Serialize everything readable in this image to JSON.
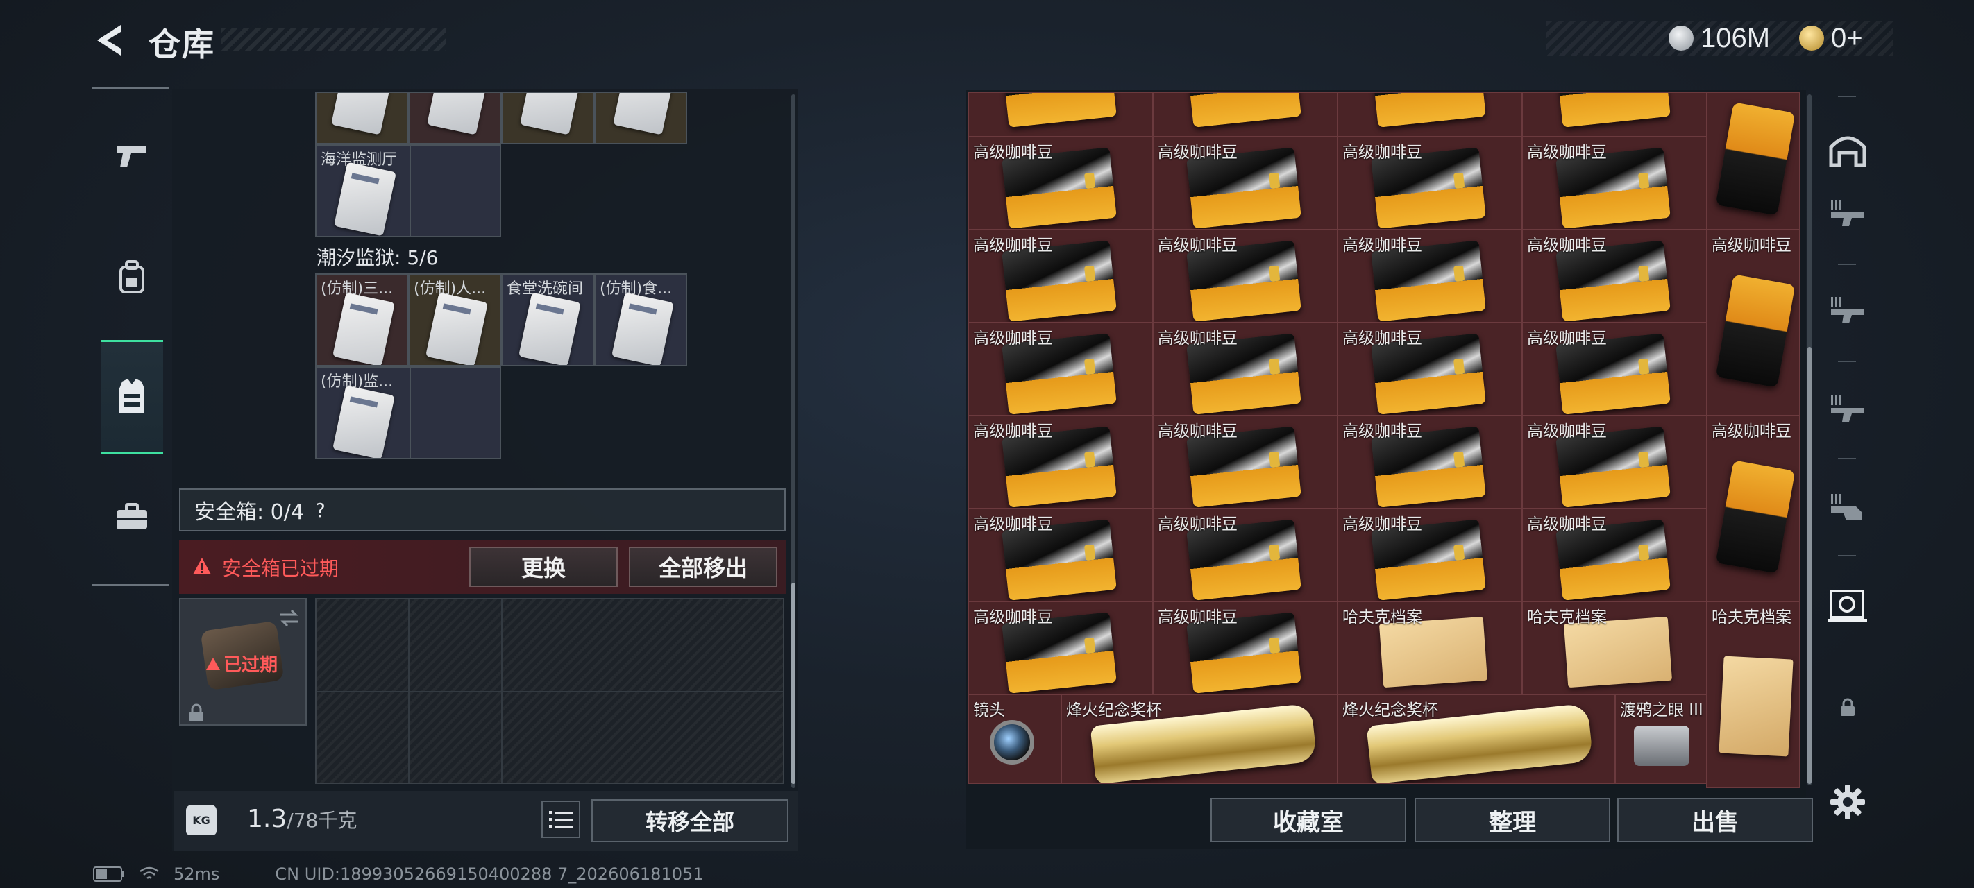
{
  "header": {
    "title": "仓库",
    "currencies": [
      {
        "icon": "silver-coin-icon",
        "value": "106M",
        "color": "#c9cdd2"
      },
      {
        "icon": "gold-triangle-coin-icon",
        "value": "0+",
        "color": "#d8b048"
      }
    ]
  },
  "left_nav": {
    "items": [
      {
        "icon": "pistol-icon",
        "active": false
      },
      {
        "icon": "backpack-icon",
        "active": false
      },
      {
        "icon": "vest-icon",
        "active": true
      },
      {
        "icon": "briefcase-icon",
        "active": false
      }
    ]
  },
  "inventory": {
    "top_row_label": "海洋监测厅",
    "prison_title": "潮汐监狱: 5/6",
    "prison_slots": [
      {
        "label": "(仿制)三..."
      },
      {
        "label": "(仿制)人..."
      },
      {
        "label": "食堂洗碗间"
      },
      {
        "label": "(仿制)食..."
      },
      {
        "label": "(仿制)监..."
      }
    ]
  },
  "safe_box": {
    "label": "安全箱: 0/4",
    "help": "?",
    "expired_text": "安全箱已过期",
    "replace_label": "更换",
    "move_all_label": "全部移出",
    "expired_badge": "已过期"
  },
  "weight": {
    "current": "1.3",
    "max": "/78千克",
    "transfer_all_label": "转移全部"
  },
  "status": {
    "ping": "52ms",
    "uid": "CN UID:18993052669150400288 7_202606181051"
  },
  "storage": {
    "coffee_label": "高级咖啡豆",
    "hafk_label": "哈夫克档案",
    "lens_label": "镜头",
    "trophy_label": "烽火纪念奖杯",
    "raven_label": "渡鸦之眼 III",
    "buttons": {
      "collection": "收藏室",
      "sort": "整理",
      "sell": "出售"
    }
  },
  "right_nav": {
    "items": [
      "vault-icon",
      "rack-1-icon",
      "rack-2-icon",
      "rack-3-icon",
      "rack-4-icon",
      "safe-room-icon",
      "lock-icon"
    ],
    "settings_icon": "gear-icon"
  },
  "colors": {
    "accent": "#3ee0a0",
    "alert_red": "#ff5a5a",
    "cell_bg": "#4a2326"
  }
}
